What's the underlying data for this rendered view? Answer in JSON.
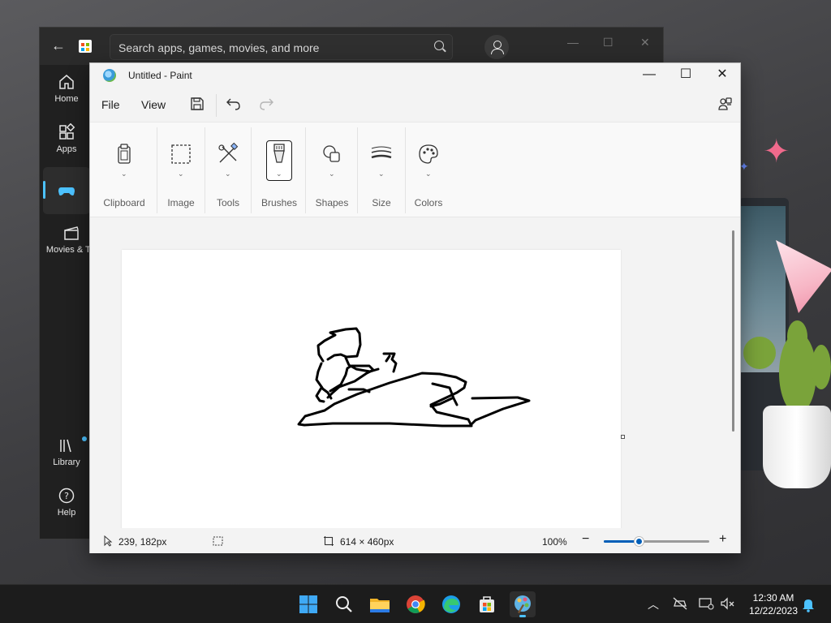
{
  "store": {
    "search_placeholder": "Search apps, games, movies, and more",
    "nav": [
      {
        "label": "Home",
        "icon": "home-icon"
      },
      {
        "label": "Apps",
        "icon": "apps-icon"
      },
      {
        "label": "",
        "icon": "gaming-icon"
      },
      {
        "label": "Movies & TV",
        "icon": "movies-icon"
      },
      {
        "label": "Library",
        "icon": "library-icon"
      },
      {
        "label": "Help",
        "icon": "help-icon"
      }
    ]
  },
  "paint": {
    "title": "Untitled - Paint",
    "menu": {
      "file": "File",
      "view": "View"
    },
    "ribbon": {
      "clipboard": "Clipboard",
      "image": "Image",
      "tools": "Tools",
      "brushes": "Brushes",
      "shapes": "Shapes",
      "size": "Size",
      "colors": "Colors"
    },
    "status": {
      "cursor_position": "239, 182px",
      "canvas_size": "614 × 460px",
      "zoom": "100%",
      "zoom_level": 0.33
    },
    "colors": {
      "accent": "#005fb8",
      "stroke": "#000000"
    }
  },
  "taskbar": {
    "apps": [
      "Start",
      "Search",
      "File Explorer",
      "Chrome",
      "Edge",
      "Microsoft Store",
      "Paint"
    ],
    "time": "12:30 AM",
    "date": "12/22/2023"
  }
}
